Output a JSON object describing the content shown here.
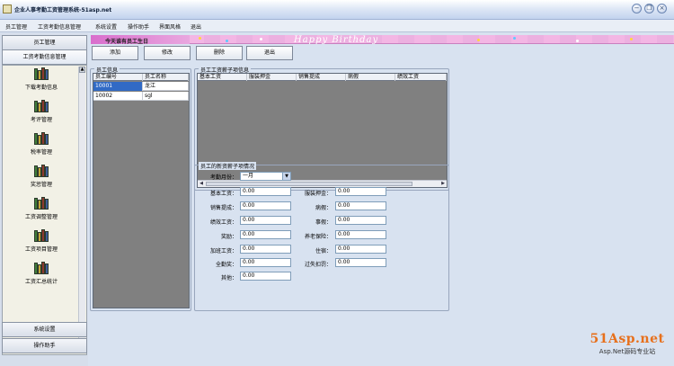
{
  "window": {
    "title": "企业人事考勤工资管理系统-51asp.net",
    "buttons": {
      "minimize": "−",
      "restore": "❐",
      "close": "×"
    }
  },
  "menu": [
    "员工管理",
    "工资考勤信息管理",
    "系统设置",
    "操作助手",
    "界面风格",
    "退出"
  ],
  "sidebar": {
    "headers": [
      "员工管理",
      "工资考勤信息管理"
    ],
    "items": [
      {
        "label": "下载考勤信息",
        "icon": "books-icon"
      },
      {
        "label": "考评管理",
        "icon": "books-icon"
      },
      {
        "label": "税率管理",
        "icon": "books-icon"
      },
      {
        "label": "奖惩管理",
        "icon": "books-icon"
      },
      {
        "label": "工资调整管理",
        "icon": "books-icon"
      },
      {
        "label": "工资项目管理",
        "icon": "books-icon"
      },
      {
        "label": "工资汇总统计",
        "icon": "books-icon"
      }
    ],
    "footer_headers": [
      "系统设置",
      "操作助手"
    ],
    "scroll_up": "▲",
    "scroll_down": "▼"
  },
  "banner": {
    "title": "今天谁有员工生日",
    "text": "Happy Birthday"
  },
  "toolbar": {
    "add": "添加",
    "edit": "修改",
    "delete": "删除",
    "exit": "退出"
  },
  "employee_info": {
    "caption": "员工信息",
    "columns": [
      "员工编号",
      "员工名称"
    ],
    "rows": [
      [
        "10001",
        "龙江"
      ],
      [
        "10002",
        "sgl"
      ]
    ]
  },
  "salary_items": {
    "caption": "员工工资薪子项信息",
    "columns": [
      "基本工资",
      "服装押金",
      "销售提成",
      "病假",
      "绩效工资"
    ],
    "scroll_left": "◀",
    "scroll_right": "▶"
  },
  "new_salary": {
    "caption": "员工的新资薪子项情况",
    "month_label": "考勤月份：",
    "month_value": "一月",
    "left_fields": [
      {
        "label": "基本工资：",
        "value": "0.00"
      },
      {
        "label": "销售提成：",
        "value": "0.00"
      },
      {
        "label": "绩效工资：",
        "value": "0.00"
      },
      {
        "label": "奖励：",
        "value": "0.00"
      },
      {
        "label": "加班工资：",
        "value": "0.00"
      },
      {
        "label": "全勤奖：",
        "value": "0.00"
      },
      {
        "label": "其他：",
        "value": "0.00"
      }
    ],
    "right_fields": [
      {
        "label": "服装押金：",
        "value": "0.00"
      },
      {
        "label": "病假：",
        "value": "0.00"
      },
      {
        "label": "事假：",
        "value": "0.00"
      },
      {
        "label": "养老保险：",
        "value": "0.00"
      },
      {
        "label": "住宿：",
        "value": "0.00"
      },
      {
        "label": "过失扣罚：",
        "value": "0.00"
      }
    ]
  },
  "watermark": {
    "logo": "51Asp.net",
    "subtitle": "Asp.Net源码专业站"
  }
}
